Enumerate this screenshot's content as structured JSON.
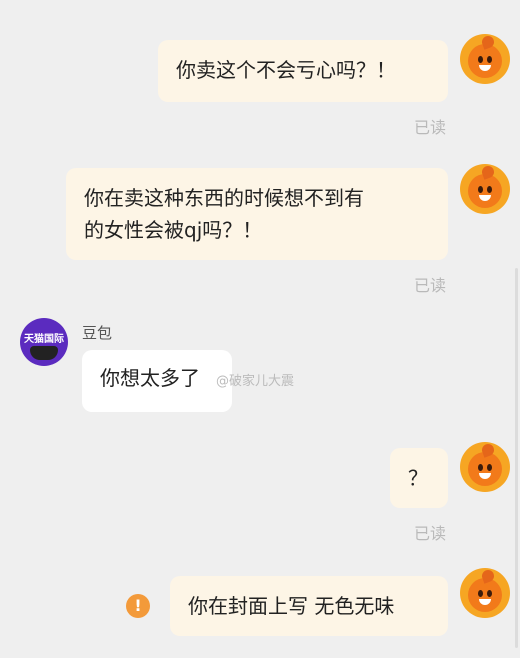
{
  "messages": [
    {
      "from": "self",
      "text": "你卖这个不会亏心吗？！",
      "status": "已读"
    },
    {
      "from": "self",
      "text_line1": "你在卖这种东西的时候想不到有",
      "text_line2": "的女性会被qj吗？！",
      "status": "已读"
    },
    {
      "from": "other",
      "sender": "豆包",
      "avatar_text": "天猫国际",
      "text": "你想太多了"
    },
    {
      "from": "self",
      "text": "？",
      "status": "已读"
    },
    {
      "from": "self",
      "text": "你在封面上写  无色无味",
      "warning_icon": "!"
    }
  ],
  "watermark": "@破家儿大震",
  "colors": {
    "background": "#efefef",
    "self_bubble": "#fdf5e6",
    "other_bubble": "#ffffff",
    "read_status": "#b9b9b9",
    "warning": "#f39a3a"
  }
}
